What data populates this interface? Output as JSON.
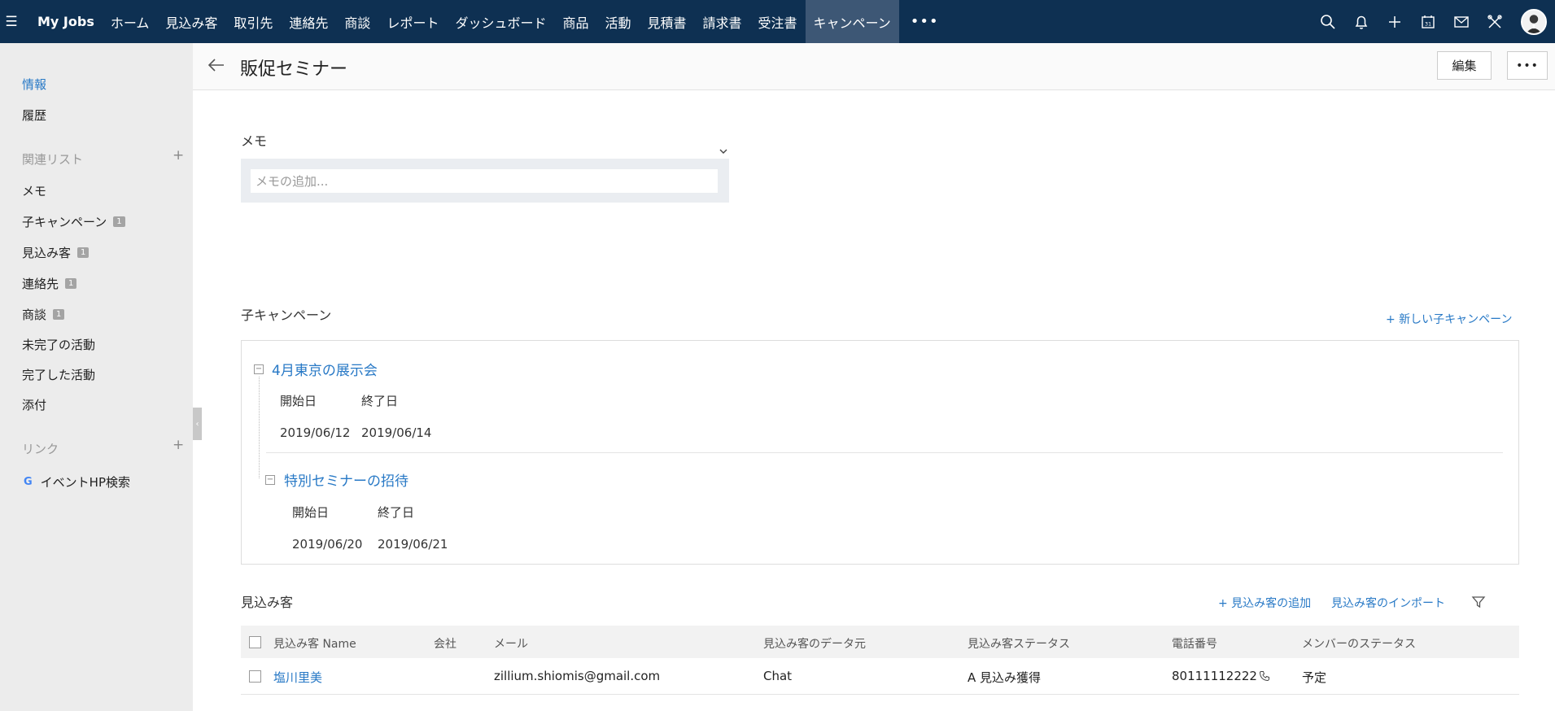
{
  "app": {
    "brand": "My Jobs"
  },
  "nav": {
    "tabs": [
      "ホーム",
      "見込み客",
      "取引先",
      "連絡先",
      "商談",
      "レポート",
      "ダッシュボード",
      "商品",
      "活動",
      "見積書",
      "請求書",
      "受注書",
      "キャンペーン"
    ],
    "active_tab": "キャンペーン",
    "more": "•••",
    "calendar_day": "31"
  },
  "sidebar": {
    "info": "情報",
    "history": "履歴",
    "related_list_heading": "関連リスト",
    "related": [
      {
        "label": "メモ",
        "count": ""
      },
      {
        "label": "子キャンペーン",
        "count": "1"
      },
      {
        "label": "見込み客",
        "count": "1"
      },
      {
        "label": "連絡先",
        "count": "1"
      },
      {
        "label": "商談",
        "count": "1"
      },
      {
        "label": "未完了の活動",
        "count": ""
      },
      {
        "label": "完了した活動",
        "count": ""
      },
      {
        "label": "添付",
        "count": ""
      }
    ],
    "links_heading": "リンク",
    "link_item": "イベントHP検索",
    "google_letter": "G"
  },
  "header": {
    "title": "販促セミナー",
    "edit_label": "編集",
    "more_label": "•••"
  },
  "memo": {
    "title": "メモ",
    "placeholder": "メモの追加..."
  },
  "child_campaigns": {
    "title": "子キャンペーン",
    "new_link": "+ 新しい子キャンペーン",
    "items": [
      {
        "name": "4月東京の展示会",
        "start_label": "開始日",
        "end_label": "終了日",
        "start": "2019/06/12",
        "end": "2019/06/14"
      },
      {
        "name": "特別セミナーの招待",
        "start_label": "開始日",
        "end_label": "終了日",
        "start": "2019/06/20",
        "end": "2019/06/21"
      }
    ]
  },
  "leads": {
    "title": "見込み客",
    "add_link": "+ 見込み客の追加",
    "import_link": "見込み客のインポート",
    "columns": [
      "見込み客 Name",
      "会社",
      "メール",
      "見込み客のデータ元",
      "見込み客ステータス",
      "電話番号",
      "メンバーのステータス"
    ],
    "rows": [
      {
        "name": "塩川里美",
        "company": "",
        "email": "zillium.shiomis@gmail.com",
        "source": "Chat",
        "status": "A 見込み獲得",
        "phone": "80111112222",
        "member_status": "予定"
      }
    ]
  },
  "colors": {
    "nav_bg": "#0e3052",
    "nav_active": "#3d5775",
    "link": "#2879c6",
    "sidebar_bg": "#ececec"
  }
}
